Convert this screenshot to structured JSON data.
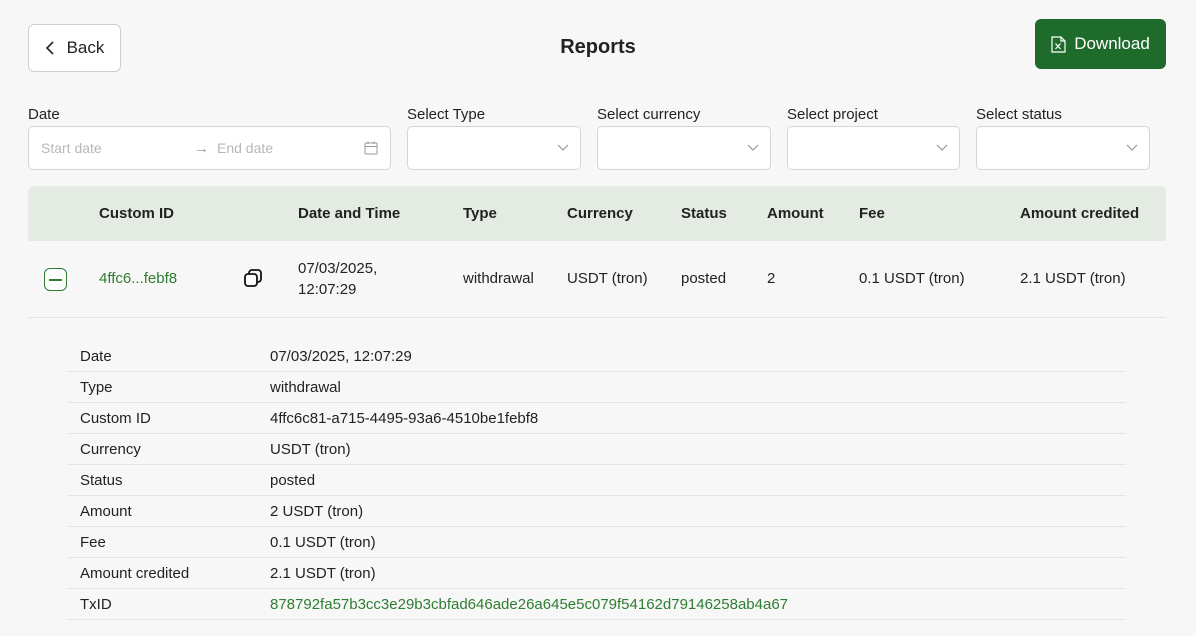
{
  "header": {
    "back_label": "Back",
    "title": "Reports",
    "download_label": "Download"
  },
  "filters": {
    "date_label": "Date",
    "start_placeholder": "Start date",
    "end_placeholder": "End date",
    "type_label": "Select Type",
    "currency_label": "Select currency",
    "project_label": "Select project",
    "status_label": "Select status"
  },
  "table": {
    "columns": [
      "Custom ID",
      "Date and Time",
      "Type",
      "Currency",
      "Status",
      "Amount",
      "Fee",
      "Amount credited"
    ],
    "rows": [
      {
        "custom_id": "4ffc6...febf8",
        "date_line1": "07/03/2025,",
        "date_line2": "12:07:29",
        "type": "withdrawal",
        "currency": "USDT (tron)",
        "status": "posted",
        "amount": "2",
        "fee": "0.1 USDT (tron)",
        "amount_credited": "2.1 USDT (tron)"
      }
    ]
  },
  "details": [
    {
      "label": "Date",
      "value": "07/03/2025, 12:07:29"
    },
    {
      "label": "Type",
      "value": "withdrawal"
    },
    {
      "label": "Custom ID",
      "value": "4ffc6c81-a715-4495-93a6-4510be1febf8"
    },
    {
      "label": "Currency",
      "value": "USDT (tron)"
    },
    {
      "label": "Status",
      "value": "posted"
    },
    {
      "label": "Amount",
      "value": "2 USDT (tron)"
    },
    {
      "label": "Fee",
      "value": "0.1 USDT (tron)"
    },
    {
      "label": "Amount credited",
      "value": "2.1 USDT (tron)"
    },
    {
      "label": "TxID",
      "value": "878792fa57b3cc3e29b3cbfad646ade26a645e5c079f54162d79146258ab4a67"
    }
  ],
  "colors": {
    "accent": "#2e7d32",
    "download_bg": "#1f6b2b",
    "table_header_bg": "#e3ebe3"
  }
}
